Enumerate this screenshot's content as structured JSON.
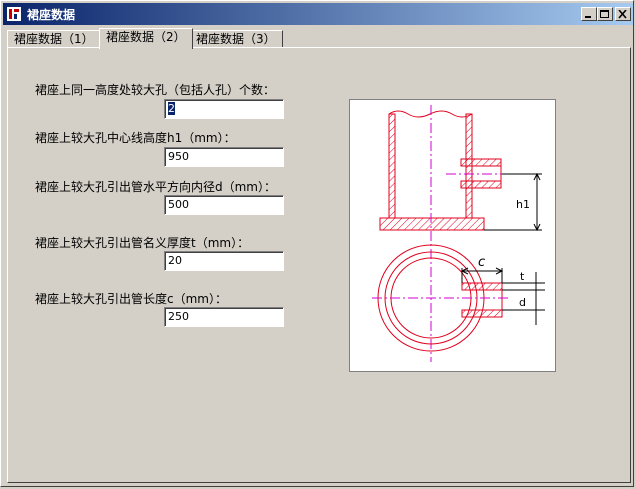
{
  "window": {
    "title": "裙座数据"
  },
  "tabs": [
    {
      "label": "裙座数据（1）"
    },
    {
      "label": "裙座数据（2）"
    },
    {
      "label": "裙座数据（3）"
    }
  ],
  "active_tab": 1,
  "fields": [
    {
      "label": "裙座上同一高度处较大孔（包括人孔）个数：",
      "value": "2"
    },
    {
      "label": "裙座上较大孔中心线高度h1（mm）：",
      "value": "950"
    },
    {
      "label": "裙座上较大孔引出管水平方向内径d（mm）：",
      "value": "500"
    },
    {
      "label": "裙座上较大孔引出管名义厚度t（mm）：",
      "value": "20"
    },
    {
      "label": "裙座上较大孔引出管长度c（mm）：",
      "value": "250"
    }
  ],
  "figure": {
    "labels": {
      "h1": "h1",
      "c": "c",
      "t": "t",
      "d": "d"
    },
    "colors": {
      "line": "#e0001c",
      "center": "#d000d0",
      "dim": "#000000"
    }
  }
}
